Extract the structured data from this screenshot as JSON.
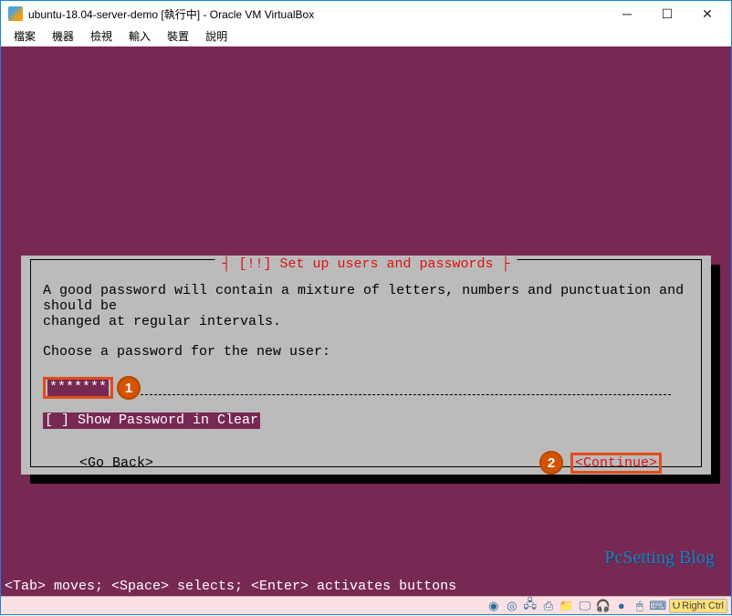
{
  "window": {
    "title": "ubuntu-18.04-server-demo [執行中] - Oracle VM VirtualBox"
  },
  "menubar": {
    "items": [
      "檔案",
      "機器",
      "檢視",
      "輸入",
      "裝置",
      "說明"
    ]
  },
  "dialog": {
    "title": "[!!] Set up users and passwords",
    "body_line1": "A good password will contain a mixture of letters, numbers and punctuation and should be",
    "body_line2": "changed at regular intervals.",
    "prompt": "Choose a password for the new user:",
    "password_value": "*******",
    "show_password_label": "[ ] Show Password in Clear",
    "go_back": "<Go Back>",
    "continue": "<Continue>"
  },
  "annotations": {
    "badge1": "1",
    "badge2": "2"
  },
  "hints": "<Tab> moves; <Space> selects; <Enter> activates buttons",
  "watermark": "PcSetting Blog",
  "statusbar": {
    "host_key": "Right Ctrl"
  }
}
